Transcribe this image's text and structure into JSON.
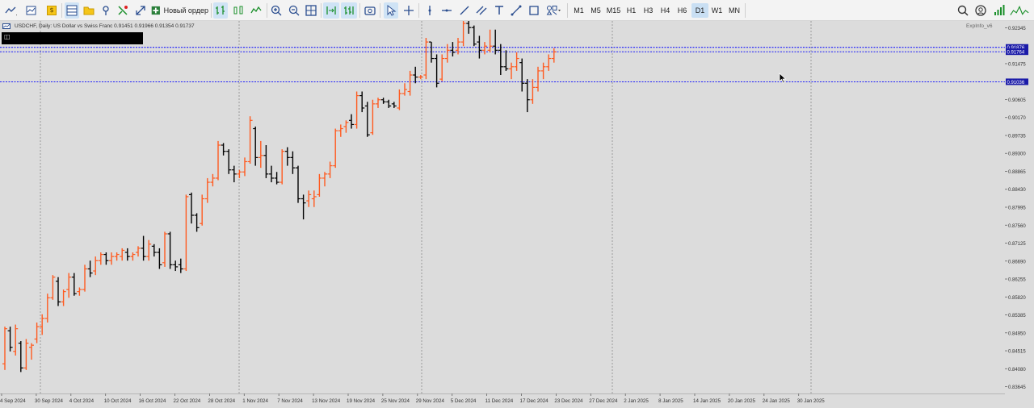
{
  "toolbar": {
    "new_order_label": "Новый ордер",
    "timeframes": [
      "M1",
      "M5",
      "M15",
      "H1",
      "H3",
      "H4",
      "H6",
      "D1",
      "W1",
      "MN"
    ],
    "active_timeframe": "D1"
  },
  "chart": {
    "symbol_info": "USDCHF, Daily:  US Dollar vs Swiss Franc  0.91451 0.91966 0.91354 0.91737",
    "indicator_label": "ExpInfo_v6",
    "bull_color": "#ff5a1f",
    "bear_color": "#000000",
    "background": "#dcdcdc",
    "level_color": "#0000ff"
  },
  "chart_data": {
    "type": "ohlc",
    "symbol": "USDCHF",
    "timeframe": "Daily",
    "price_ticks": [
      "0.92345",
      "0.91475",
      "0.90605",
      "0.90170",
      "0.89735",
      "0.89300",
      "0.88865",
      "0.88430",
      "0.87995",
      "0.87560",
      "0.87125",
      "0.86690",
      "0.86255",
      "0.85820",
      "0.85385",
      "0.84950",
      "0.84515",
      "0.84080",
      "0.83645"
    ],
    "date_ticks": [
      "4 Sep 2024",
      "30 Sep 2024",
      "4 Oct 2024",
      "10 Oct 2024",
      "16 Oct 2024",
      "22 Oct 2024",
      "28 Oct 2024",
      "1 Nov 2024",
      "7 Nov 2024",
      "13 Nov 2024",
      "19 Nov 2024",
      "25 Nov 2024",
      "29 Nov 2024",
      "5 Dec 2024",
      "11 Dec 2024",
      "17 Dec 2024",
      "23 Dec 2024",
      "27 Dec 2024",
      "2 Jan 2025",
      "8 Jan 2025",
      "14 Jan 2025",
      "20 Jan 2025",
      "24 Jan 2025",
      "30 Jan 2025"
    ],
    "levels": [
      {
        "price": 0.9187,
        "label": "0.91876"
      },
      {
        "price": 0.91764,
        "label": "0.91764"
      },
      {
        "price": 0.91036,
        "label": "0.91036"
      }
    ],
    "ylim": [
      0.8348,
      0.9251
    ],
    "bars": [
      [
        0.842,
        0.851,
        0.8405,
        0.8505
      ],
      [
        0.85,
        0.851,
        0.845,
        0.846
      ],
      [
        0.845,
        0.8515,
        0.844,
        0.8505
      ],
      [
        0.847,
        0.8475,
        0.84,
        0.841
      ],
      [
        0.841,
        0.848,
        0.8405,
        0.847
      ],
      [
        0.846,
        0.847,
        0.843,
        0.8465
      ],
      [
        0.848,
        0.852,
        0.847,
        0.851
      ],
      [
        0.851,
        0.854,
        0.849,
        0.853
      ],
      [
        0.853,
        0.859,
        0.852,
        0.858
      ],
      [
        0.858,
        0.8635,
        0.8575,
        0.863
      ],
      [
        0.862,
        0.863,
        0.856,
        0.857
      ],
      [
        0.857,
        0.86,
        0.856,
        0.8595
      ],
      [
        0.86,
        0.864,
        0.858,
        0.863
      ],
      [
        0.863,
        0.864,
        0.8585,
        0.859
      ],
      [
        0.8595,
        0.8605,
        0.8585,
        0.86
      ],
      [
        0.86,
        0.866,
        0.8595,
        0.865
      ],
      [
        0.865,
        0.867,
        0.863,
        0.864
      ],
      [
        0.8645,
        0.868,
        0.8635,
        0.867
      ],
      [
        0.867,
        0.869,
        0.866,
        0.8685
      ],
      [
        0.8685,
        0.869,
        0.866,
        0.867
      ],
      [
        0.867,
        0.869,
        0.866,
        0.868
      ],
      [
        0.868,
        0.869,
        0.867,
        0.8685
      ],
      [
        0.868,
        0.87,
        0.867,
        0.8695
      ],
      [
        0.869,
        0.87,
        0.867,
        0.868
      ],
      [
        0.868,
        0.869,
        0.867,
        0.8685
      ],
      [
        0.869,
        0.8705,
        0.868,
        0.87
      ],
      [
        0.87,
        0.873,
        0.867,
        0.868
      ],
      [
        0.868,
        0.872,
        0.867,
        0.871
      ],
      [
        0.8705,
        0.871,
        0.868,
        0.869
      ],
      [
        0.869,
        0.87,
        0.865,
        0.866
      ],
      [
        0.8665,
        0.874,
        0.8655,
        0.8735
      ],
      [
        0.8735,
        0.874,
        0.865,
        0.866
      ],
      [
        0.866,
        0.867,
        0.8645,
        0.8655
      ],
      [
        0.866,
        0.8675,
        0.864,
        0.865
      ],
      [
        0.865,
        0.883,
        0.8645,
        0.8825
      ],
      [
        0.883,
        0.8835,
        0.876,
        0.878
      ],
      [
        0.878,
        0.8785,
        0.874,
        0.875
      ],
      [
        0.876,
        0.883,
        0.8755,
        0.882
      ],
      [
        0.882,
        0.887,
        0.881,
        0.886
      ],
      [
        0.886,
        0.888,
        0.885,
        0.887
      ],
      [
        0.887,
        0.896,
        0.8865,
        0.895
      ],
      [
        0.895,
        0.8955,
        0.8925,
        0.8935
      ],
      [
        0.8935,
        0.894,
        0.888,
        0.889
      ],
      [
        0.889,
        0.89,
        0.886,
        0.888
      ],
      [
        0.888,
        0.889,
        0.887,
        0.8885
      ],
      [
        0.8885,
        0.892,
        0.8875,
        0.891
      ],
      [
        0.891,
        0.902,
        0.8905,
        0.901
      ],
      [
        0.899,
        0.8995,
        0.89,
        0.892
      ],
      [
        0.892,
        0.896,
        0.8895,
        0.8925
      ],
      [
        0.8925,
        0.895,
        0.887,
        0.888
      ],
      [
        0.888,
        0.89,
        0.886,
        0.887
      ],
      [
        0.887,
        0.8885,
        0.8855,
        0.886
      ],
      [
        0.886,
        0.894,
        0.8855,
        0.8935
      ],
      [
        0.8935,
        0.8945,
        0.89,
        0.892
      ],
      [
        0.892,
        0.8935,
        0.888,
        0.8895
      ],
      [
        0.8895,
        0.89,
        0.881,
        0.882
      ],
      [
        0.882,
        0.883,
        0.877,
        0.881
      ],
      [
        0.8815,
        0.884,
        0.88,
        0.883
      ],
      [
        0.882,
        0.884,
        0.88,
        0.8825
      ],
      [
        0.883,
        0.888,
        0.8825,
        0.887
      ],
      [
        0.887,
        0.8885,
        0.885,
        0.888
      ],
      [
        0.888,
        0.891,
        0.887,
        0.89
      ],
      [
        0.89,
        0.899,
        0.8895,
        0.8985
      ],
      [
        0.8985,
        0.9,
        0.897,
        0.899
      ],
      [
        0.8995,
        0.901,
        0.898,
        0.9005
      ],
      [
        0.901,
        0.9025,
        0.899,
        0.9
      ],
      [
        0.9,
        0.908,
        0.899,
        0.907
      ],
      [
        0.907,
        0.908,
        0.903,
        0.904
      ],
      [
        0.9045,
        0.9055,
        0.897,
        0.8975
      ],
      [
        0.898,
        0.906,
        0.8975,
        0.905
      ],
      [
        0.905,
        0.9065,
        0.904,
        0.906
      ],
      [
        0.906,
        0.9065,
        0.905,
        0.9055
      ],
      [
        0.9055,
        0.906,
        0.904,
        0.9045
      ],
      [
        0.905,
        0.9055,
        0.904,
        0.9045
      ],
      [
        0.904,
        0.9085,
        0.9035,
        0.9075
      ],
      [
        0.9075,
        0.91,
        0.907,
        0.9085
      ],
      [
        0.908,
        0.913,
        0.907,
        0.912
      ],
      [
        0.912,
        0.914,
        0.91,
        0.9115
      ],
      [
        0.9115,
        0.912,
        0.911,
        0.9115
      ],
      [
        0.912,
        0.921,
        0.911,
        0.92
      ],
      [
        0.92,
        0.92,
        0.915,
        0.916
      ],
      [
        0.916,
        0.917,
        0.909,
        0.91
      ],
      [
        0.911,
        0.917,
        0.9105,
        0.916
      ],
      [
        0.916,
        0.9195,
        0.915,
        0.918
      ],
      [
        0.918,
        0.92,
        0.9165,
        0.9175
      ],
      [
        0.918,
        0.921,
        0.917,
        0.92
      ],
      [
        0.92,
        0.9255,
        0.919,
        0.9245
      ],
      [
        0.9245,
        0.926,
        0.922,
        0.9235
      ],
      [
        0.9235,
        0.924,
        0.919,
        0.9195
      ],
      [
        0.92,
        0.9215,
        0.916,
        0.918
      ],
      [
        0.918,
        0.92,
        0.917,
        0.919
      ],
      [
        0.918,
        0.923,
        0.9175,
        0.919
      ],
      [
        0.919,
        0.923,
        0.917,
        0.918
      ],
      [
        0.918,
        0.9195,
        0.912,
        0.914
      ],
      [
        0.914,
        0.918,
        0.913,
        0.9135
      ],
      [
        0.9135,
        0.915,
        0.911,
        0.914
      ],
      [
        0.914,
        0.9175,
        0.913,
        0.916
      ],
      [
        0.915,
        0.916,
        0.908,
        0.91
      ],
      [
        0.91,
        0.911,
        0.903,
        0.906
      ],
      [
        0.906,
        0.911,
        0.905,
        0.909
      ],
      [
        0.909,
        0.914,
        0.908,
        0.913
      ],
      [
        0.913,
        0.915,
        0.911,
        0.914
      ],
      [
        0.914,
        0.917,
        0.913,
        0.916
      ],
      [
        0.916,
        0.9185,
        0.915,
        0.9176
      ]
    ]
  }
}
